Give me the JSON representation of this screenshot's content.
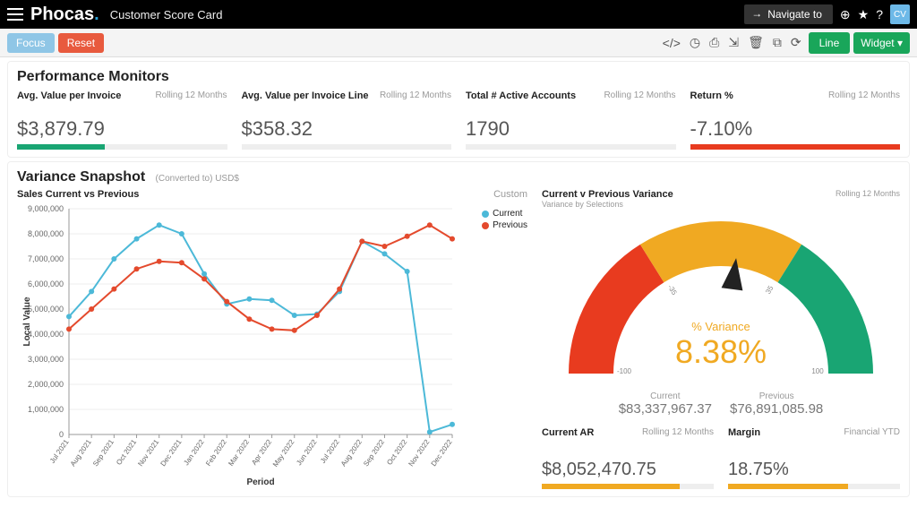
{
  "header": {
    "logo": "Phocas",
    "page_title": "Customer Score Card",
    "navigate_label": "Navigate to",
    "avatar_initials": "CV"
  },
  "toolbar": {
    "focus": "Focus",
    "reset": "Reset",
    "line": "Line",
    "widget": "Widget"
  },
  "perf": {
    "title": "Performance Monitors",
    "period": "Rolling 12 Months",
    "metrics": [
      {
        "label": "Avg. Value per Invoice",
        "value": "$3,879.79",
        "fill_pct": 42,
        "color": "green"
      },
      {
        "label": "Avg. Value per Invoice Line",
        "value": "$358.32",
        "fill_pct": 0,
        "color": "none"
      },
      {
        "label": "Total # Active Accounts",
        "value": "1790",
        "fill_pct": 0,
        "color": "none"
      },
      {
        "label": "Return %",
        "value": "-7.10%",
        "fill_pct": 100,
        "color": "red"
      }
    ]
  },
  "snapshot": {
    "title": "Variance Snapshot",
    "subtitle": "(Converted to) USD$"
  },
  "chart_data": {
    "type": "line",
    "title": "Sales Current vs Previous",
    "period": "Custom",
    "xlabel": "Period",
    "ylabel": "Local Value",
    "ylim": [
      0,
      9000000
    ],
    "yticks": [
      0,
      1000000,
      2000000,
      3000000,
      4000000,
      5000000,
      6000000,
      7000000,
      8000000,
      9000000
    ],
    "categories": [
      "Jul 2021",
      "Aug 2021",
      "Sep 2021",
      "Oct 2021",
      "Nov 2021",
      "Dec 2021",
      "Jan 2022",
      "Feb 2022",
      "Mar 2022",
      "Apr 2022",
      "May 2022",
      "Jun 2022",
      "Jul 2022",
      "Aug 2022",
      "Sep 2022",
      "Oct 2022",
      "Nov 2022",
      "Dec 2022"
    ],
    "series": [
      {
        "name": "Current",
        "color": "#4cb9d8",
        "values": [
          4700000,
          5700000,
          7000000,
          7800000,
          8350000,
          8000000,
          6400000,
          5200000,
          5400000,
          5350000,
          4750000,
          4800000,
          5700000,
          7700000,
          7200000,
          6500000,
          100000,
          400000
        ]
      },
      {
        "name": "Previous",
        "color": "#e44a2d",
        "values": [
          4200000,
          5000000,
          5800000,
          6600000,
          6900000,
          6850000,
          6200000,
          5300000,
          4600000,
          4200000,
          4150000,
          4750000,
          5800000,
          7700000,
          7500000,
          7900000,
          8350000,
          7800000
        ]
      }
    ]
  },
  "gauge": {
    "title": "Current v Previous Variance",
    "subtitle": "Variance by Selections",
    "period": "Rolling 12 Months",
    "center_label": "% Variance",
    "center_value": "8.38%",
    "ticks": [
      "-100",
      "-35",
      "35",
      "100"
    ],
    "current_label": "Current",
    "previous_label": "Previous",
    "current_value": "$83,337,967.37",
    "previous_value": "$76,891,085.98"
  },
  "bottom": {
    "ar": {
      "label": "Current AR",
      "period": "Rolling 12 Months",
      "value": "$8,052,470.75",
      "fill_pct": 80
    },
    "margin": {
      "label": "Margin",
      "period": "Financial YTD",
      "value": "18.75%",
      "fill_pct": 70
    }
  }
}
